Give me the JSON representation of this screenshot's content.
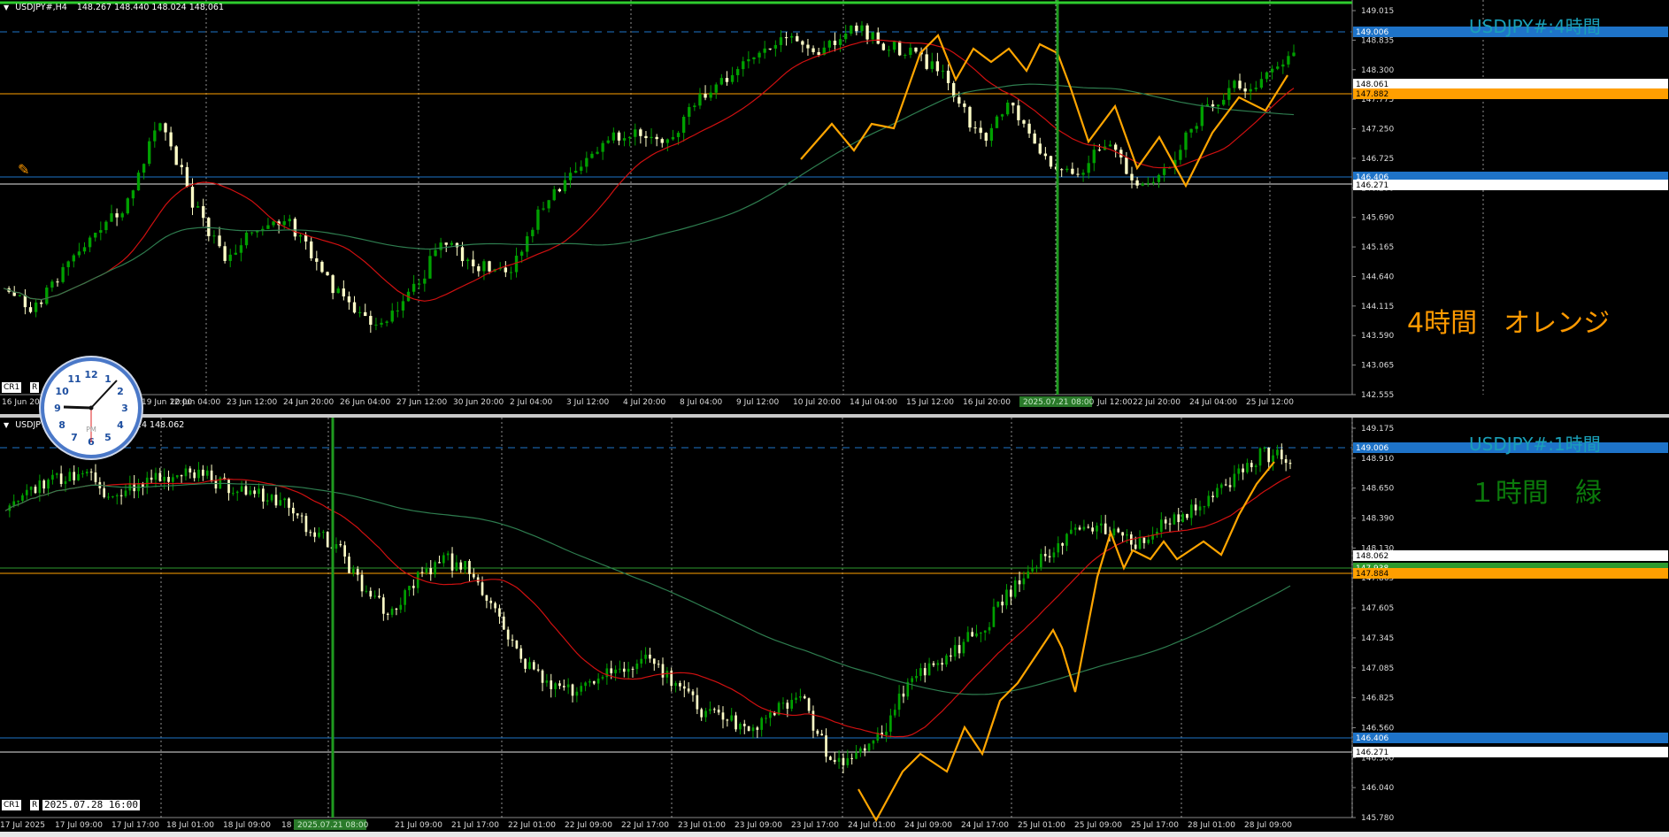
{
  "top": {
    "symbol_label": "USDJPY#,H4",
    "ohlc": "148.267 148.440 148.024 148.061",
    "watermark": "USDJPY#:4時間",
    "note": "4時間　オレンジ",
    "prices": [
      "149.015",
      "148.835",
      "148.300",
      "147.775",
      "147.250",
      "146.725",
      "146.200",
      "145.690",
      "145.165",
      "144.640",
      "144.115",
      "143.590",
      "143.065",
      "142.555"
    ],
    "marker_prices": {
      "blue_dash": "149.006",
      "current": "148.061",
      "orange": "147.882",
      "blue_line": "146.406",
      "white_line": "146.271"
    },
    "time_labels": [
      "16 Jun 2025",
      "19 Jun 12:00",
      "20 Jun 04:00",
      "23 Jun 12:00",
      "24 Jun 20:00",
      "26 Jun 04:00",
      "27 Jun 12:00",
      "30 Jun 20:00",
      "2 Jul 04:00",
      "3 Jul 12:00",
      "4 Jul 20:00",
      "8 Jul 04:00",
      "9 Jul 12:00",
      "10 Jul 20:00",
      "14 Jul 04:00",
      "15 Jul 12:00",
      "16 Jul 20:00",
      "2025.07.21 08:00",
      "Jul 12:00",
      "22 Jul 20:00",
      "24 Jul 04:00",
      "25 Jul 12:00"
    ],
    "date_box": "2025.07.21 08:00",
    "cr1": "CR1",
    "r": "R"
  },
  "bottom": {
    "symbol_label": "USDJPY#,H1",
    "ohlc_tail": "6.024 148.062",
    "watermark": "USDJPY#:1時間",
    "note": "１時間　緑",
    "prices": [
      "149.175",
      "148.910",
      "148.650",
      "148.390",
      "148.130",
      "147.865",
      "147.605",
      "147.345",
      "147.085",
      "146.825",
      "146.560",
      "146.300",
      "146.040",
      "145.780"
    ],
    "marker_prices": {
      "blue_dash": "149.006",
      "current": "148.062",
      "green": "147.938",
      "orange": "147.884",
      "blue_line": "146.406",
      "white_line": "146.271"
    },
    "time_labels": [
      "17 Jul 2025",
      "17 Jul 09:00",
      "17 Jul 17:00",
      "18 Jul 01:00",
      "18 Jul 09:00",
      "18 J",
      "2025.07.21 08:00",
      "21 Jul 09:00",
      "21 Jul 17:00",
      "22 Jul 01:00",
      "22 Jul 09:00",
      "22 Jul 17:00",
      "23 Jul 01:00",
      "23 Jul 09:00",
      "23 Jul 17:00",
      "24 Jul 01:00",
      "24 Jul 09:00",
      "24 Jul 17:00",
      "25 Jul 01:00",
      "25 Jul 09:00",
      "25 Jul 17:00",
      "28 Jul 01:00",
      "28 Jul 09:00"
    ],
    "date_box": "2025.07.28 16:00",
    "cr1": "CR1",
    "r": "R"
  },
  "clock": {
    "numbers": [
      "12",
      "1",
      "2",
      "3",
      "4",
      "5",
      "6",
      "7",
      "8",
      "9",
      "10",
      "11"
    ],
    "pm": "PM"
  },
  "colors": {
    "bull": "#00a000",
    "bear": "#ffffc8",
    "ma_fast": "#d01010",
    "ma_slow": "#2e7d4f",
    "zigzag": "#ffa500",
    "orange_line": "#ff9f00",
    "blue_line": "#1e73c8",
    "watermark": "#1aa0b8",
    "note_top": "#ff9a00",
    "note_bot": "#0b7a0b",
    "vline": "#1f9a1f"
  }
}
